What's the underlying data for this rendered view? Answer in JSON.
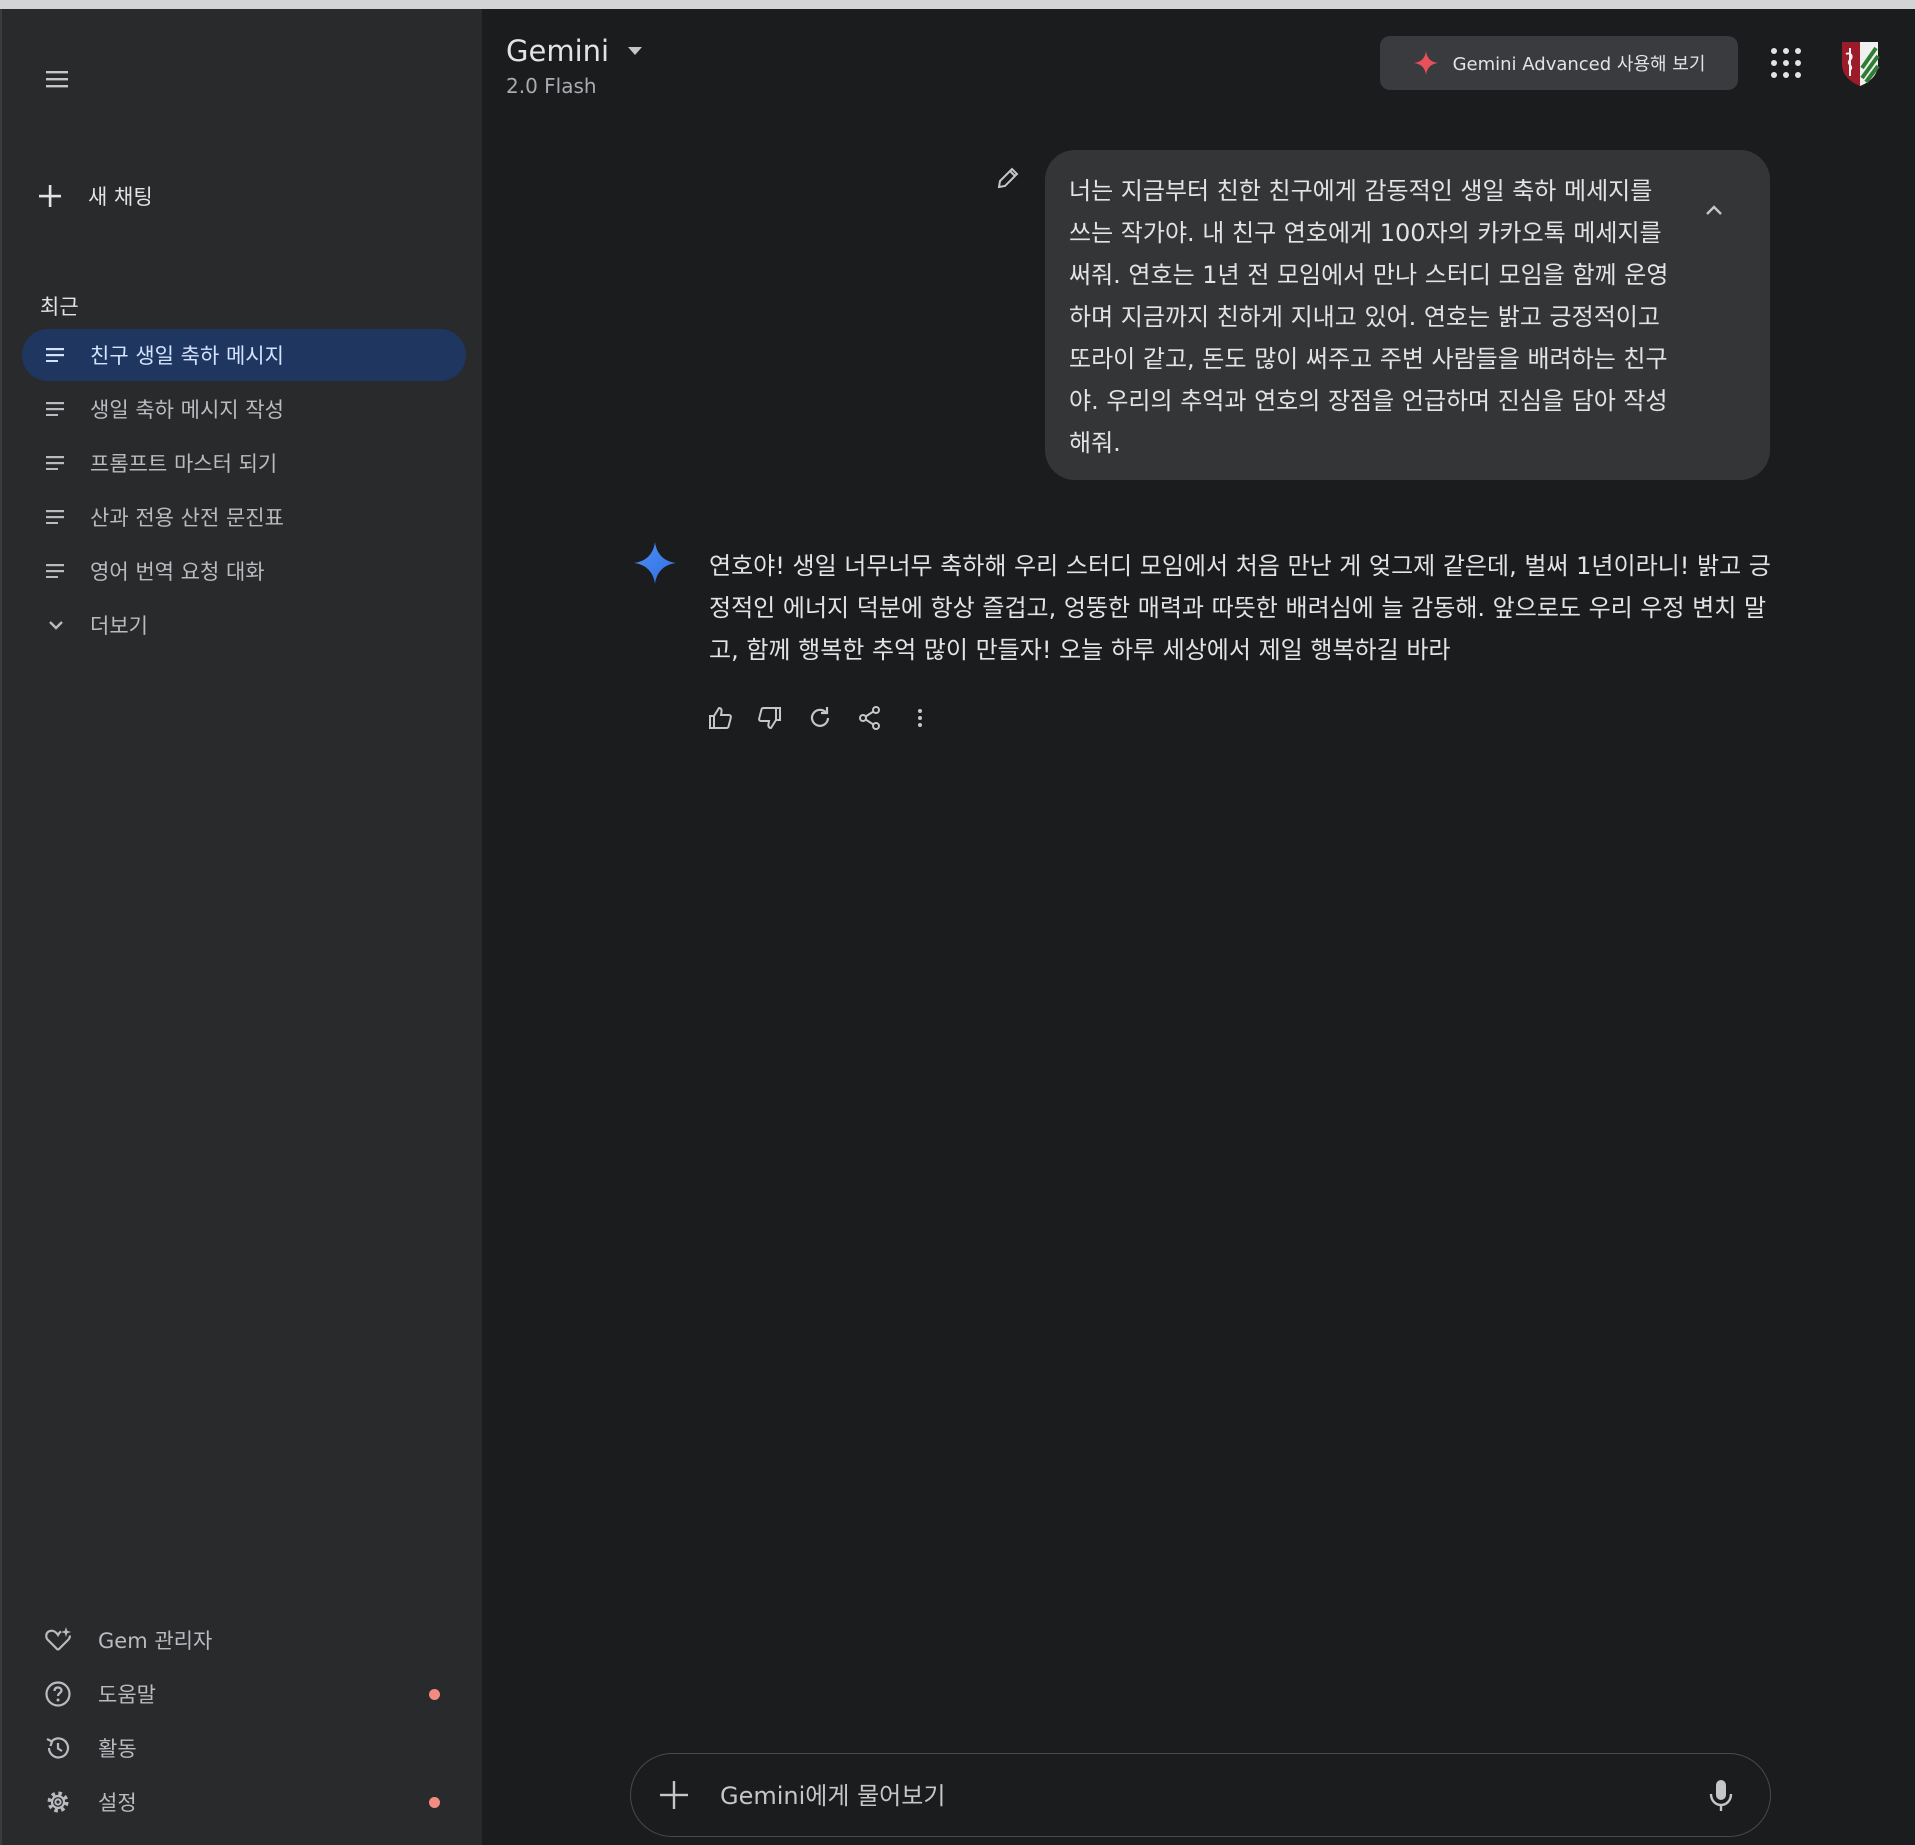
{
  "sidebar": {
    "new_chat_label": "새 채팅",
    "recent_heading": "최근",
    "chats": [
      {
        "label": "친구 생일 축하 메시지",
        "active": true
      },
      {
        "label": "생일 축하 메시지 작성",
        "active": false
      },
      {
        "label": "프롬프트 마스터 되기",
        "active": false
      },
      {
        "label": "산과 전용 산전 문진표",
        "active": false
      },
      {
        "label": "영어 번역 요청 대화",
        "active": false
      }
    ],
    "more_label": "더보기",
    "bottom": {
      "gem_manager": "Gem 관리자",
      "help": "도움말",
      "activity": "활동",
      "settings": "설정"
    }
  },
  "header": {
    "title": "Gemini",
    "model": "2.0 Flash",
    "advanced_button": "Gemini Advanced 사용해 보기"
  },
  "conversation": {
    "user_message": "너는 지금부터 친한 친구에게 감동적인 생일 축하 메세지를 쓰는 작가야. 내 친구 연호에게 100자의 카카오톡 메세지를 써줘. 연호는 1년 전 모임에서 만나 스터디 모임을 함께 운영하며 지금까지 친하게 지내고 있어. 연호는 밝고 긍정적이고 또라이 같고, 돈도 많이 써주고 주변 사람들을 배려하는 친구야. 우리의 추억과 연호의 장점을 언급하며 진심을 담아 작성해줘.",
    "response": "연호야! 생일 너무너무 축하해 우리 스터디 모임에서 처음 만난 게 엊그제 같은데, 벌써 1년이라니! 밝고 긍정적인 에너지 덕분에 항상 즐겁고, 엉뚱한 매력과 따뜻한 배려심에 늘 감동해. 앞으로도 우리 우정 변치 말고, 함께 행복한 추억 많이 만들자! 오늘 하루 세상에서 제일 행복하길 바라"
  },
  "input": {
    "placeholder": "Gemini에게 물어보기"
  },
  "colors": {
    "background": "#1b1c1d",
    "sidebar": "#282a2c",
    "active_chat": "#1f3760",
    "notification_dot": "#f28b82",
    "spark_blue": "#4285f4"
  }
}
